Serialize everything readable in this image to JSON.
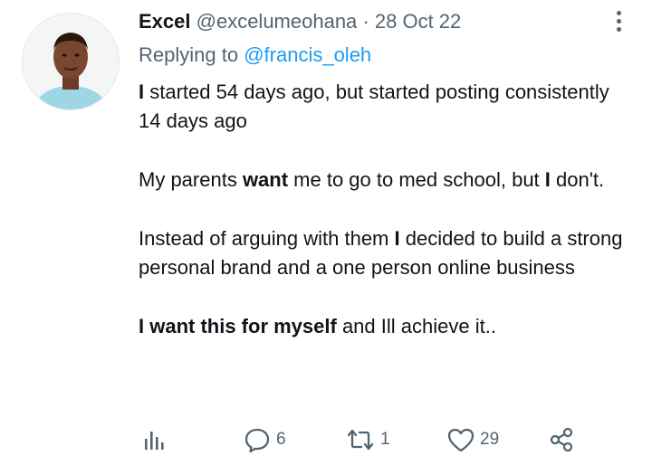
{
  "tweet": {
    "author_name": "Excel",
    "author_handle": "@excelumeohana",
    "separator": "·",
    "date": "28 Oct 22",
    "replying_prefix": "Replying to",
    "replying_to": "@francis_oleh",
    "paragraphs": [
      [
        {
          "text": "I",
          "bold": true
        },
        {
          "text": " started 54 days ago, but started posting consistently 14 days ago",
          "bold": false
        }
      ],
      [
        {
          "text": "My parents ",
          "bold": false
        },
        {
          "text": "want",
          "bold": true
        },
        {
          "text": " me to go to med school, but ",
          "bold": false
        },
        {
          "text": "I",
          "bold": true
        },
        {
          "text": " don't.",
          "bold": false
        }
      ],
      [
        {
          "text": "Instead of arguing with them ",
          "bold": false
        },
        {
          "text": "I",
          "bold": true
        },
        {
          "text": " decided to build a strong personal brand and a one person online business",
          "bold": false
        }
      ],
      [
        {
          "text": "I want this for myself",
          "bold": true
        },
        {
          "text": " and Ill achieve it..",
          "bold": false
        }
      ]
    ]
  },
  "actions": {
    "analytics_icon": "bar-chart-icon",
    "reply_icon": "speech-bubble-icon",
    "reply_count": "6",
    "retweet_icon": "retweet-arrows-icon",
    "retweet_count": "1",
    "like_icon": "heart-icon",
    "like_count": "29",
    "share_icon": "share-nodes-icon"
  },
  "colors": {
    "text": "#0f1419",
    "muted": "#536471",
    "link": "#1d9bf0"
  }
}
